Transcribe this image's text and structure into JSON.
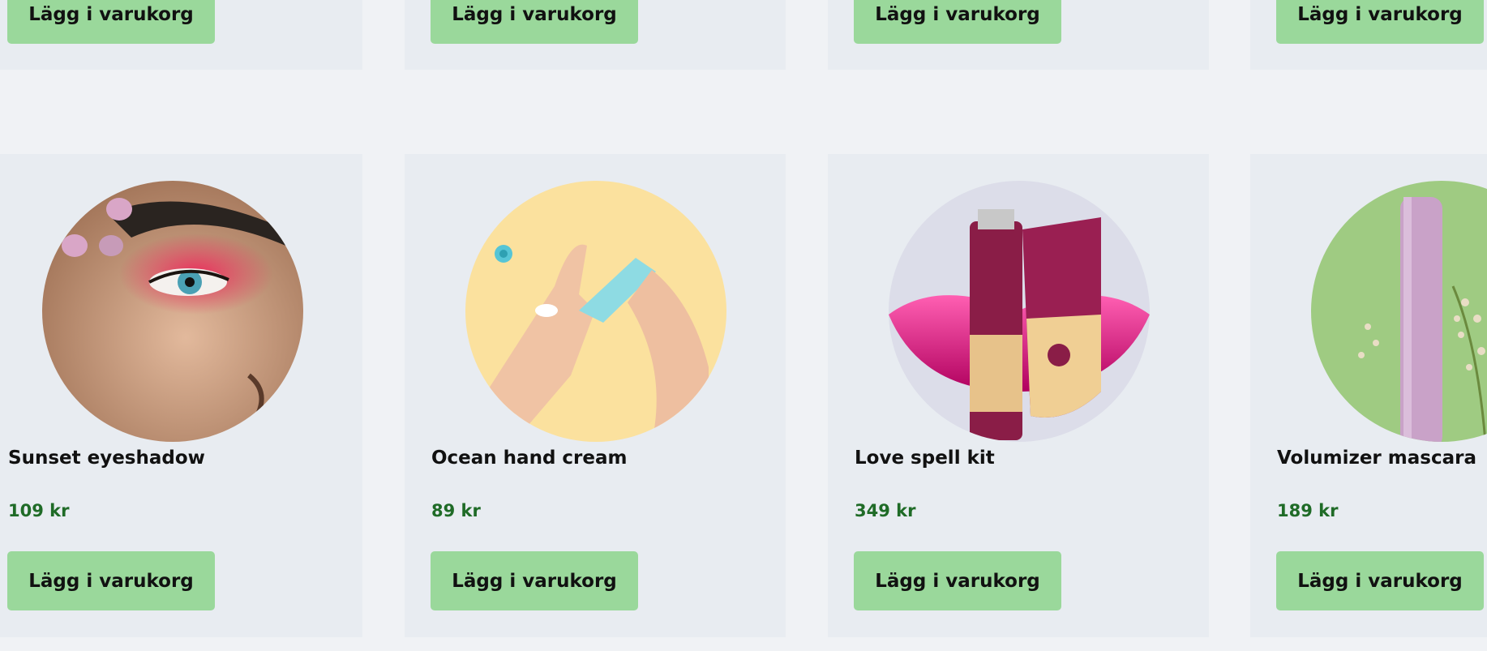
{
  "top_row": {
    "buttons": [
      {
        "label": "Lägg i varukorg"
      },
      {
        "label": "Lägg i varukorg"
      },
      {
        "label": "Lägg i varukorg"
      },
      {
        "label": "Lägg i varukorg"
      }
    ]
  },
  "products": [
    {
      "name": "Sunset eyeshadow",
      "price": "109 kr",
      "button_label": "Lägg i varukorg",
      "image": "eyeshadow-photo"
    },
    {
      "name": "Ocean hand cream",
      "price": "89 kr",
      "button_label": "Lägg i varukorg",
      "image": "hand-cream-photo"
    },
    {
      "name": "Love spell kit",
      "price": "349 kr",
      "button_label": "Lägg i varukorg",
      "image": "love-spell-kit-photo"
    },
    {
      "name": "Volumizer mascara",
      "price": "189 kr",
      "button_label": "Lägg i varukorg",
      "image": "mascara-photo"
    }
  ],
  "colors": {
    "page_background": "#f0f2f5",
    "card_background": "#e8ecf1",
    "button_background": "#9ad89b",
    "price_text": "#1f6b27"
  }
}
